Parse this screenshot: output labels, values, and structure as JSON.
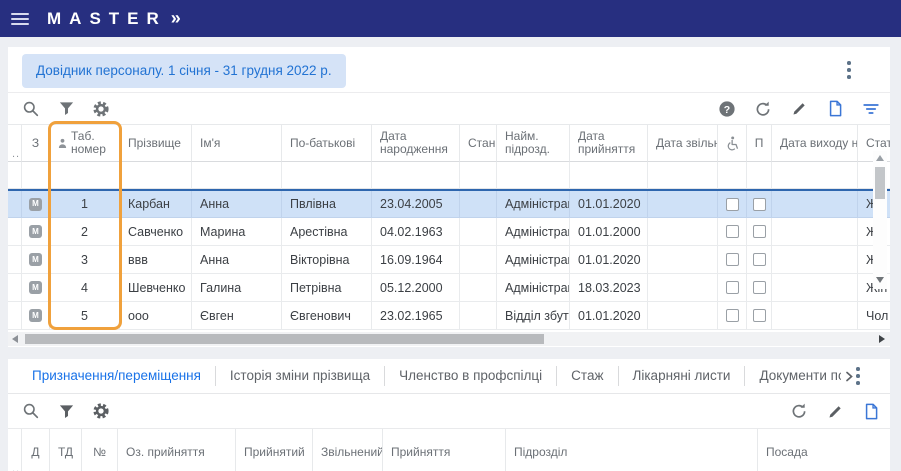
{
  "app": {
    "brand": "MASTER",
    "brand_arrows": "»"
  },
  "header": {
    "title": "Довідник персоналу. 1 січня - 31 грудня 2022 р."
  },
  "toolbar_main": {
    "left_icons": [
      "search",
      "filter",
      "settings"
    ],
    "right_icons": [
      "help",
      "refresh",
      "edit",
      "new-document",
      "sort-filter"
    ]
  },
  "personnel_table": {
    "corner": "...",
    "badge": "M",
    "columns": {
      "z": "З",
      "tab_number": "Таб. номер",
      "last_name": "Прізвище",
      "first_name": "Ім'я",
      "middle_name": "По-батькові",
      "birth_date": "Дата народження",
      "state": "Стан н",
      "hire_dept": "Найм. підрозд.",
      "hire_date": "Дата прийняття",
      "dismiss_date": "Дата звільнен",
      "disability_icon": "wheelchair",
      "p": "П",
      "exit_date": "Дата виходу н",
      "gender": "Стать"
    },
    "rows": [
      {
        "tab_number": "1",
        "last_name": "Карбан",
        "first_name": "Анна",
        "middle_name": "Пвлівна",
        "birth_date": "23.04.2005",
        "hire_dept": "Адміністрація",
        "hire_date": "01.01.2020",
        "gender": "Жін",
        "disability": false,
        "p": false,
        "selected": true
      },
      {
        "tab_number": "2",
        "last_name": "Савченко",
        "first_name": "Марина",
        "middle_name": "Арестівна",
        "birth_date": "04.02.1963",
        "hire_dept": "Адміністрація",
        "hire_date": "01.01.2000",
        "gender": "Жін",
        "disability": false,
        "p": false,
        "selected": false
      },
      {
        "tab_number": "3",
        "last_name": "ввв",
        "first_name": "Анна",
        "middle_name": "Вікторівна",
        "birth_date": "16.09.1964",
        "hire_dept": "Адміністрація",
        "hire_date": "01.01.2020",
        "gender": "Жін",
        "disability": false,
        "p": false,
        "selected": false
      },
      {
        "tab_number": "4",
        "last_name": "Шевченко",
        "first_name": "Галина",
        "middle_name": "Петрівна",
        "birth_date": "05.12.2000",
        "hire_dept": "Адміністрація",
        "hire_date": "18.03.2023",
        "gender": "Жін",
        "disability": false,
        "p": false,
        "selected": false
      },
      {
        "tab_number": "5",
        "last_name": "ооо",
        "first_name": "Євген",
        "middle_name": "Євгенович",
        "birth_date": "23.02.1965",
        "hire_dept": "Відділ збуту",
        "hire_date": "01.01.2020",
        "gender": "Чол",
        "disability": false,
        "p": false,
        "selected": false
      }
    ]
  },
  "tabs": {
    "items": [
      {
        "label": "Призначення/переміщення",
        "active": true
      },
      {
        "label": "Історія зміни прізвища",
        "active": false
      },
      {
        "label": "Членство в профспілці",
        "active": false
      },
      {
        "label": "Стаж",
        "active": false
      },
      {
        "label": "Лікарняні листи",
        "active": false
      },
      {
        "label": "Документи по середнь",
        "active": false
      }
    ]
  },
  "toolbar_detail": {
    "left_icons": [
      "search",
      "filter",
      "settings"
    ],
    "right_icons": [
      "refresh",
      "edit",
      "new-document"
    ]
  },
  "detail_table": {
    "corner": "...",
    "columns": {
      "d": "Д",
      "td": "ТД",
      "no": "№",
      "oz": "Оз. прийняття",
      "hired": "Прийнятий",
      "dismissed": "Звільнений",
      "hiring": "Прийняття",
      "department": "Підрозділ",
      "position": "Посада"
    }
  },
  "colors": {
    "navbar": "#272f80",
    "accent_blue": "#1a73e8",
    "selection": "#cfe1f7",
    "column_highlight": "#f0a13c"
  }
}
